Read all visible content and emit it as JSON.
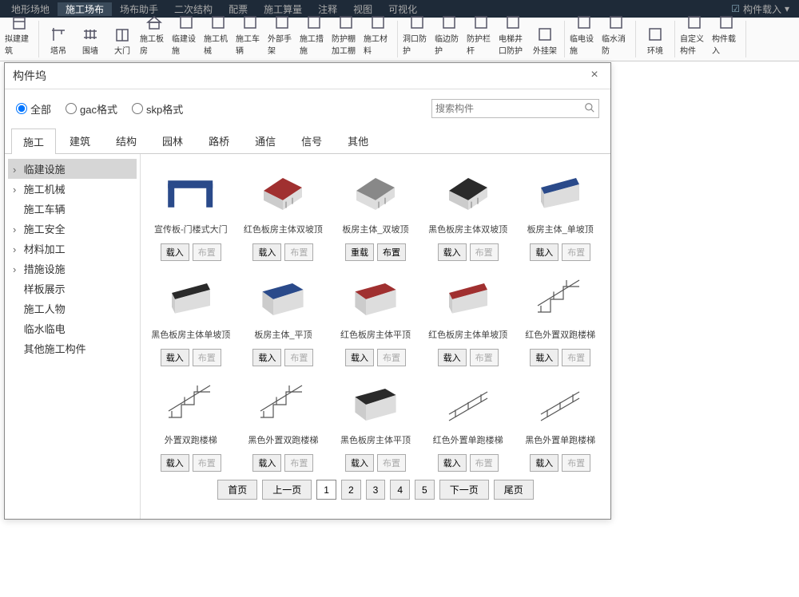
{
  "menu": [
    "地形场地",
    "施工场布",
    "场布助手",
    "二次结构",
    "配票",
    "施工算量",
    "注释",
    "视图",
    "可视化"
  ],
  "menu_active": 1,
  "top_right": "构件载入",
  "ribbon": [
    {
      "items": [
        {
          "k": "build1",
          "l": "拟建建筑"
        }
      ]
    },
    {
      "items": [
        {
          "k": "tower",
          "l": "塔吊"
        },
        {
          "k": "fence",
          "l": "围墙"
        },
        {
          "k": "gate",
          "l": "大门"
        },
        {
          "k": "house",
          "l": "施工板房"
        },
        {
          "k": "temp",
          "l": "临建设施"
        },
        {
          "k": "machine",
          "l": "施工机械"
        },
        {
          "k": "vehicle",
          "l": "施工车辆"
        },
        {
          "k": "scaffold",
          "l": "外部手架"
        },
        {
          "k": "measure",
          "l": "施工措施"
        },
        {
          "k": "protect",
          "l": "防护棚加工棚"
        },
        {
          "k": "material",
          "l": "施工材料"
        }
      ]
    },
    {
      "items": [
        {
          "k": "open",
          "l": "洞口防护"
        },
        {
          "k": "edge",
          "l": "临边防护"
        },
        {
          "k": "rail",
          "l": "防护栏杆"
        },
        {
          "k": "elev",
          "l": "电梯井口防护"
        },
        {
          "k": "hang",
          "l": "外挂架"
        }
      ]
    },
    {
      "items": [
        {
          "k": "elec",
          "l": "临电设施"
        },
        {
          "k": "fire",
          "l": "临水消防"
        }
      ]
    },
    {
      "items": [
        {
          "k": "env",
          "l": "环境"
        }
      ]
    },
    {
      "items": [
        {
          "k": "custom",
          "l": "自定义构件"
        },
        {
          "k": "import",
          "l": "构件载入"
        }
      ]
    }
  ],
  "dialog": {
    "title": "构件坞",
    "radios": [
      "全部",
      "gac格式",
      "skp格式"
    ],
    "search_ph": "搜索构件",
    "tabs": [
      "施工",
      "建筑",
      "结构",
      "园林",
      "路桥",
      "通信",
      "信号",
      "其他"
    ],
    "tree": [
      {
        "l": "临建设施",
        "sel": true,
        "a": true
      },
      {
        "l": "施工机械",
        "a": true
      },
      {
        "l": "施工车辆",
        "a": false
      },
      {
        "l": "施工安全",
        "a": true
      },
      {
        "l": "材料加工",
        "a": true
      },
      {
        "l": "措施设施",
        "a": true
      },
      {
        "l": "样板展示",
        "a": false
      },
      {
        "l": "施工人物",
        "a": false
      },
      {
        "l": "临水临电",
        "a": false
      },
      {
        "l": "其他施工构件",
        "a": false
      }
    ],
    "btn_load": "载入",
    "btn_place": "布置",
    "btn_reload": "重载",
    "cards": [
      {
        "n": "宣传板-门楼式大门",
        "b1": "载入",
        "b2": "布置",
        "b2d": true,
        "svg": "gate"
      },
      {
        "n": "红色板房主体双坡顶",
        "b1": "载入",
        "b2": "布置",
        "b2d": true,
        "svg": "roof_red"
      },
      {
        "n": "板房主体_双坡顶",
        "b1": "重载",
        "b2": "布置",
        "b2d": false,
        "svg": "roof_gray"
      },
      {
        "n": "黑色板房主体双坡顶",
        "b1": "载入",
        "b2": "布置",
        "b2d": true,
        "svg": "roof_black"
      },
      {
        "n": "板房主体_单坡顶",
        "b1": "载入",
        "b2": "布置",
        "b2d": true,
        "svg": "shed_blue"
      },
      {
        "n": "黑色板房主体单坡顶",
        "b1": "载入",
        "b2": "布置",
        "b2d": true,
        "svg": "shed_black"
      },
      {
        "n": "板房主体_平顶",
        "b1": "载入",
        "b2": "布置",
        "b2d": true,
        "svg": "flat_blue"
      },
      {
        "n": "红色板房主体平顶",
        "b1": "载入",
        "b2": "布置",
        "b2d": true,
        "svg": "flat_red"
      },
      {
        "n": "红色板房主体单坡顶",
        "b1": "载入",
        "b2": "布置",
        "b2d": true,
        "svg": "shed_red"
      },
      {
        "n": "红色外置双跑楼梯",
        "b1": "载入",
        "b2": "布置",
        "b2d": true,
        "svg": "stair"
      },
      {
        "n": "外置双跑楼梯",
        "b1": "载入",
        "b2": "布置",
        "b2d": true,
        "svg": "stair"
      },
      {
        "n": "黑色外置双跑楼梯",
        "b1": "载入",
        "b2": "布置",
        "b2d": true,
        "svg": "stair"
      },
      {
        "n": "黑色板房主体平顶",
        "b1": "载入",
        "b2": "布置",
        "b2d": true,
        "svg": "flat_black"
      },
      {
        "n": "红色外置单跑楼梯",
        "b1": "载入",
        "b2": "布置",
        "b2d": true,
        "svg": "stair1"
      },
      {
        "n": "黑色外置单跑楼梯",
        "b1": "载入",
        "b2": "布置",
        "b2d": true,
        "svg": "stair1"
      }
    ],
    "pager": {
      "first": "首页",
      "prev": "上一页",
      "pages": [
        "1",
        "2",
        "3",
        "4",
        "5"
      ],
      "active": 0,
      "next": "下一页",
      "last": "尾页"
    }
  }
}
